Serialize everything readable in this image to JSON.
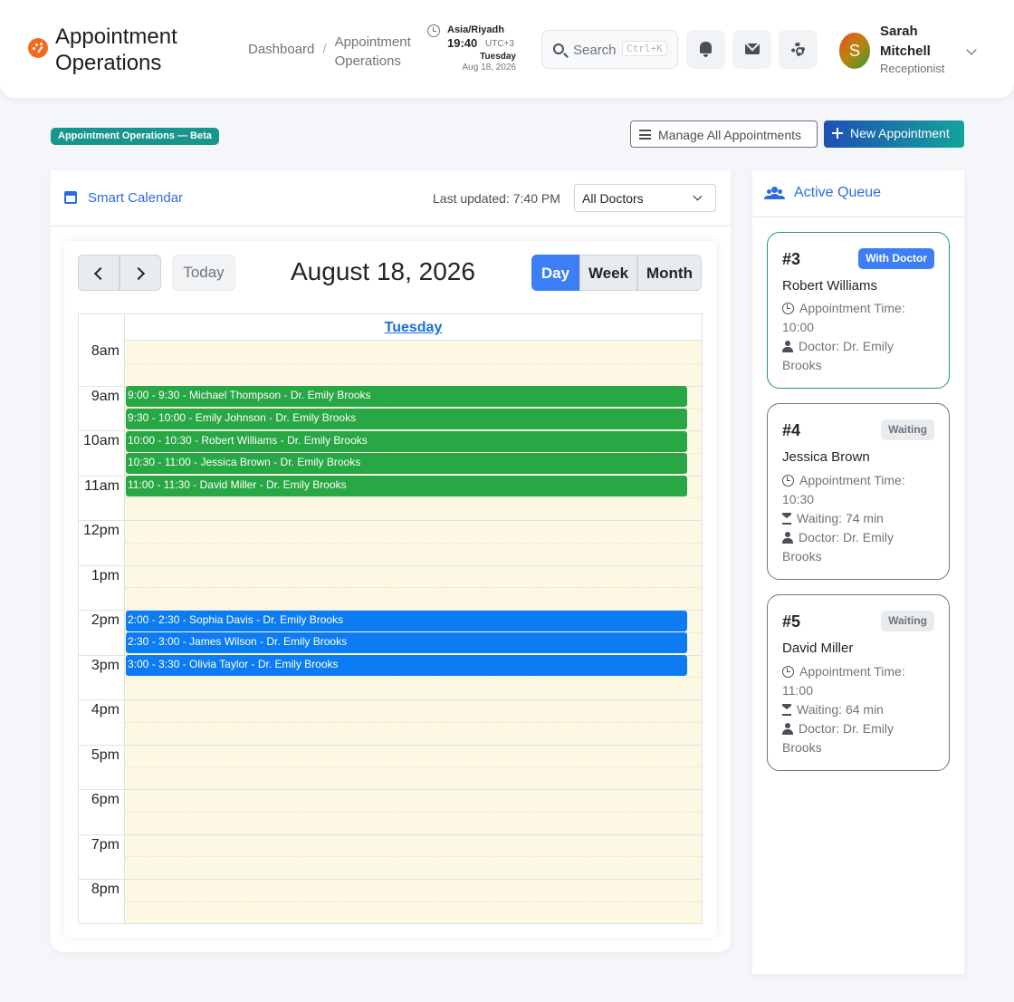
{
  "header": {
    "app_title": "Appointment Operations",
    "breadcrumb": {
      "home": "Dashboard",
      "separator": "/",
      "current": "Appointment Operations"
    },
    "clock": {
      "timezone": "Asia/Riyadh",
      "time": "19:40",
      "offset": "UTC+3",
      "day": "Tuesday",
      "date": "Aug 18, 2026"
    },
    "search": {
      "label": "Search",
      "shortcut": "Ctrl+K"
    },
    "icons": [
      "bell-icon",
      "mail-icon",
      "gear-icon"
    ],
    "user": {
      "initial": "S",
      "name": "Sarah Mitchell",
      "role": "Receptionist"
    }
  },
  "toolbar": {
    "badge": "Appointment Operations — Beta",
    "manage_label": "Manage All Appointments",
    "new_label": "New Appointment"
  },
  "calendar": {
    "title": "Smart Calendar",
    "last_updated": "Last updated: 7:40 PM",
    "doctor_filter": "All Doctors",
    "today_label": "Today",
    "date_title": "August 18, 2026",
    "views": {
      "day": "Day",
      "week": "Week",
      "month": "Month"
    },
    "active_view": "Day",
    "day_header": "Tuesday",
    "hours": [
      "8am",
      "9am",
      "10am",
      "11am",
      "12pm",
      "1pm",
      "2pm",
      "3pm",
      "4pm",
      "5pm",
      "6pm",
      "7pm",
      "8pm"
    ],
    "events": [
      {
        "label": "9:00 - 9:30 - Michael Thompson - Dr. Emily Brooks",
        "start": 9.0,
        "color": "#28a745"
      },
      {
        "label": "9:30 - 10:00 - Emily Johnson - Dr. Emily Brooks",
        "start": 9.5,
        "color": "#28a745"
      },
      {
        "label": "10:00 - 10:30 - Robert Williams - Dr. Emily Brooks",
        "start": 10.0,
        "color": "#28a745"
      },
      {
        "label": "10:30 - 11:00 - Jessica Brown - Dr. Emily Brooks",
        "start": 10.5,
        "color": "#28a745"
      },
      {
        "label": "11:00 - 11:30 - David Miller - Dr. Emily Brooks",
        "start": 11.0,
        "color": "#28a745"
      },
      {
        "label": "2:00 - 2:30 - Sophia Davis - Dr. Emily Brooks",
        "start": 14.0,
        "color": "#0d7cf2"
      },
      {
        "label": "2:30 - 3:00 - James Wilson - Dr. Emily Brooks",
        "start": 14.5,
        "color": "#0d7cf2"
      },
      {
        "label": "3:00 - 3:30 - Olivia Taylor - Dr. Emily Brooks",
        "start": 15.0,
        "color": "#0d7cf2"
      }
    ]
  },
  "queue": {
    "title": "Active Queue",
    "cards": [
      {
        "number": "#3",
        "status": "With Doctor",
        "status_type": "doctor",
        "name": "Robert Williams",
        "time": "Appointment Time: 10:00",
        "waiting": "",
        "doctor": "Doctor: Dr. Emily Brooks"
      },
      {
        "number": "#4",
        "status": "Waiting",
        "status_type": "waiting",
        "name": "Jessica Brown",
        "time": "Appointment Time: 10:30",
        "waiting": "Waiting: 74 min",
        "doctor": "Doctor: Dr. Emily Brooks"
      },
      {
        "number": "#5",
        "status": "Waiting",
        "status_type": "waiting",
        "name": "David Miller",
        "time": "Appointment Time: 11:00",
        "waiting": "Waiting: 64 min",
        "doctor": "Doctor: Dr. Emily Brooks"
      }
    ]
  },
  "colors": {
    "accent": "#2b6de0",
    "brand_orange": "#f26b1d",
    "teal": "#17968d",
    "event_green": "#28a745",
    "event_blue": "#0d7cf2",
    "day_bg": "#fcf8e3"
  }
}
